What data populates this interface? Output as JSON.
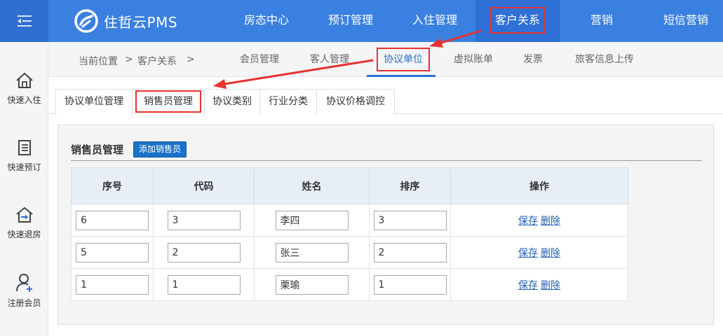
{
  "brand": {
    "name": "住哲云PMS"
  },
  "topnav": [
    {
      "label": "房态中心",
      "active": false
    },
    {
      "label": "预订管理",
      "active": false
    },
    {
      "label": "入住管理",
      "active": false
    },
    {
      "label": "客户关系",
      "active": true
    },
    {
      "label": "营销",
      "active": false
    },
    {
      "label": "短信营销",
      "active": false
    }
  ],
  "sidebar": [
    {
      "label": "快速入住",
      "icon": "home-icon"
    },
    {
      "label": "快速预订",
      "icon": "document-icon"
    },
    {
      "label": "快速退房",
      "icon": "checkout-icon"
    },
    {
      "label": "注册会员",
      "icon": "add-user-icon"
    }
  ],
  "breadcrumb": {
    "prefix": "当前位置",
    "sep1": ">",
    "section": "客户关系",
    "sep2": ">"
  },
  "subtabs": [
    {
      "label": "会员管理"
    },
    {
      "label": "客人管理"
    },
    {
      "label": "协议单位"
    },
    {
      "label": "虚拟账单"
    },
    {
      "label": "发票"
    },
    {
      "label": "旅客信息上传"
    }
  ],
  "tabs": [
    {
      "label": "协议单位管理"
    },
    {
      "label": "销售员管理"
    },
    {
      "label": "协议类别"
    },
    {
      "label": "行业分类"
    },
    {
      "label": "协议价格调控"
    }
  ],
  "panel": {
    "title": "销售员管理",
    "add_button": "添加销售员",
    "columns": [
      "序号",
      "代码",
      "姓名",
      "排序",
      "操作"
    ],
    "rows": [
      {
        "seq": "6",
        "code": "3",
        "name": "李四",
        "order": "3"
      },
      {
        "seq": "5",
        "code": "2",
        "name": "张三",
        "order": "2"
      },
      {
        "seq": "1",
        "code": "1",
        "name": "栗瑜",
        "order": "1"
      }
    ],
    "save_label": "保存",
    "delete_label": "删除"
  },
  "colors": {
    "topbar": "#3a80e0",
    "accent": "#2f70d6",
    "highlight": "#e8322e",
    "button": "#1a72c9"
  }
}
